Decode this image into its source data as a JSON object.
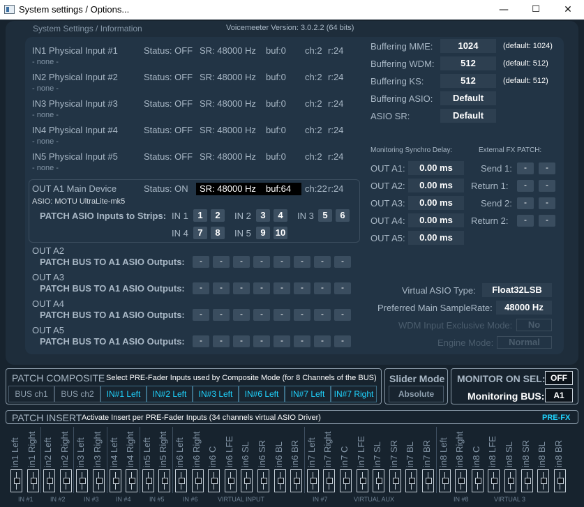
{
  "window": {
    "title": "System settings / Options...",
    "minimize": "—",
    "maximize": "☐",
    "close": "✕"
  },
  "header": {
    "section": "System Settings / Information",
    "version": "Voicemeeter Version: 3.0.2.2 (64 bits)"
  },
  "inputs": [
    {
      "name": "IN1 Physical Input #1",
      "status": "Status: OFF",
      "sr": "SR: 48000 Hz",
      "buf": "buf:0",
      "ch": "ch:2",
      "r": "r:24",
      "device": "- none -"
    },
    {
      "name": "IN2 Physical Input #2",
      "status": "Status: OFF",
      "sr": "SR: 48000 Hz",
      "buf": "buf:0",
      "ch": "ch:2",
      "r": "r:24",
      "device": "- none -"
    },
    {
      "name": "IN3 Physical Input #3",
      "status": "Status: OFF",
      "sr": "SR: 48000 Hz",
      "buf": "buf:0",
      "ch": "ch:2",
      "r": "r:24",
      "device": "- none -"
    },
    {
      "name": "IN4 Physical Input #4",
      "status": "Status: OFF",
      "sr": "SR: 48000 Hz",
      "buf": "buf:0",
      "ch": "ch:2",
      "r": "r:24",
      "device": "- none -"
    },
    {
      "name": "IN5 Physical Input #5",
      "status": "Status: OFF",
      "sr": "SR: 48000 Hz",
      "buf": "buf:0",
      "ch": "ch:2",
      "r": "r:24",
      "device": "- none -"
    }
  ],
  "outA1": {
    "name": "OUT A1 Main Device",
    "status": "Status: ON",
    "sr": "SR: 48000 Hz",
    "buf": "buf:64",
    "ch": "ch:22",
    "r": "r:24",
    "device": "ASIO: MOTU UltraLite-mk5",
    "patch_label": "PATCH ASIO Inputs to Strips:",
    "strips": [
      {
        "label": "IN 1",
        "a": "1",
        "b": "2"
      },
      {
        "label": "IN 2",
        "a": "3",
        "b": "4"
      },
      {
        "label": "IN 3",
        "a": "5",
        "b": "6"
      },
      {
        "label": "IN 4",
        "a": "7",
        "b": "8"
      },
      {
        "label": "IN 5",
        "a": "9",
        "b": "10"
      }
    ]
  },
  "out_buses": [
    {
      "name": "OUT A2",
      "patch": "PATCH BUS TO A1 ASIO Outputs:"
    },
    {
      "name": "OUT A3",
      "patch": "PATCH BUS TO A1 ASIO Outputs:"
    },
    {
      "name": "OUT A4",
      "patch": "PATCH BUS TO A1 ASIO Outputs:"
    },
    {
      "name": "OUT A5",
      "patch": "PATCH BUS TO A1 ASIO Outputs:"
    }
  ],
  "dash": "-",
  "buffering": [
    {
      "label": "Buffering MME:",
      "value": "1024",
      "default": "(default: 1024)"
    },
    {
      "label": "Buffering WDM:",
      "value": "512",
      "default": "(default: 512)"
    },
    {
      "label": "Buffering KS:",
      "value": "512",
      "default": "(default: 512)"
    },
    {
      "label": "Buffering ASIO:",
      "value": "Default",
      "default": ""
    },
    {
      "label": "ASIO SR:",
      "value": "Default",
      "default": ""
    }
  ],
  "monitoring": {
    "title": "Monitoring Synchro Delay:",
    "rows": [
      {
        "label": "OUT A1:",
        "value": "0.00 ms"
      },
      {
        "label": "OUT A2:",
        "value": "0.00 ms"
      },
      {
        "label": "OUT A3:",
        "value": "0.00 ms"
      },
      {
        "label": "OUT A4:",
        "value": "0.00 ms"
      },
      {
        "label": "OUT A5:",
        "value": "0.00 ms"
      }
    ]
  },
  "fx": {
    "title": "External FX PATCH:",
    "rows": [
      {
        "label": "Send 1:"
      },
      {
        "label": "Return 1:"
      },
      {
        "label": "Send 2:"
      },
      {
        "label": "Return 2:"
      }
    ]
  },
  "virtual": {
    "asio_type_label": "Virtual ASIO Type:",
    "asio_type": "Float32LSB",
    "samplerate_label": "Preferred Main SampleRate:",
    "samplerate": "48000 Hz",
    "wdm_label": "WDM Input Exclusive Mode:",
    "wdm": "No",
    "engine_label": "Engine Mode:",
    "engine": "Normal"
  },
  "composite": {
    "title": "PATCH COMPOSITE",
    "desc": "Select PRE-Fader Inputs used by Composite Mode (for 8 Channels of the BUS)",
    "buttons": [
      "BUS ch1",
      "BUS ch2",
      "IN#1 Left",
      "IN#2 Left",
      "IN#3 Left",
      "IN#6 Left",
      "IN#7 Left",
      "IN#7 Right"
    ]
  },
  "slider": {
    "title": "Slider Mode",
    "value": "Absolute"
  },
  "monitor": {
    "title": "MONITOR ON SEL:",
    "value": "OFF",
    "bus_label": "Monitoring BUS:",
    "bus": "A1"
  },
  "insert": {
    "title": "PATCH INSERT",
    "desc": "Activate Insert per PRE-Fader Inputs (34 channels virtual ASIO Driver)",
    "mode": "PRE-FX",
    "channels": [
      "in1 Left",
      "in1 Right",
      "in2 Left",
      "in2 Right",
      "in3 Left",
      "in3 Right",
      "in4 Left",
      "in4 Right",
      "in5 Left",
      "in5 Right",
      "in6 Left",
      "in6 Right",
      "in6 C",
      "in6 LFE",
      "in6 SL",
      "in6 SR",
      "in6 BL",
      "in6 BR",
      "in7 Left",
      "in7 Right",
      "in7 C",
      "in7 LFE",
      "in7 SL",
      "in7 SR",
      "in7 BL",
      "in7 BR",
      "in8 Left",
      "in8 Right",
      "in8 C",
      "in8 LFE",
      "in8 SL",
      "in8 SR",
      "in8 BL",
      "in8 BR"
    ],
    "groups": [
      "IN #1",
      "IN #2",
      "IN #3",
      "IN #4",
      "IN #5",
      "IN #6",
      "VIRTUAL INPUT",
      "IN #7",
      "VIRTUAL AUX",
      "IN #8",
      "VIRTUAL 3"
    ]
  },
  "colors": {
    "accent": "#1fd4ff",
    "panel": "#1e2d3b",
    "value_bg": "#2d3f50"
  }
}
